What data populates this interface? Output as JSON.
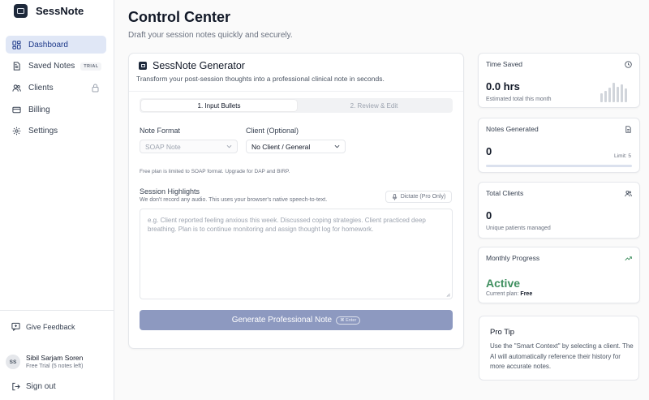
{
  "app": {
    "name": "SessNote"
  },
  "sidebar": {
    "items": [
      {
        "label": "Dashboard",
        "icon": "dashboard-icon",
        "active": true
      },
      {
        "label": "Saved Notes",
        "icon": "notes-icon",
        "badge": "TRIAL"
      },
      {
        "label": "Clients",
        "icon": "users-icon",
        "locked": true
      },
      {
        "label": "Billing",
        "icon": "credit-card-icon"
      },
      {
        "label": "Settings",
        "icon": "gear-icon"
      }
    ],
    "feedback_label": "Give Feedback",
    "user": {
      "initials": "SS",
      "name": "Sibil Sarjam Soren",
      "plan": "Free Trial (5 notes left)"
    },
    "signout_label": "Sign out"
  },
  "header": {
    "title": "Control Center",
    "subtitle": "Draft your session notes quickly and securely."
  },
  "generator": {
    "title": "SessNote Generator",
    "subtitle": "Transform your post-session thoughts into a professional clinical note in seconds.",
    "steps": [
      "1. Input Bullets",
      "2. Review & Edit"
    ],
    "format_label": "Note Format",
    "format_value": "SOAP Note",
    "client_label": "Client (Optional)",
    "client_value": "No Client / General",
    "plan_note": "Free plan is limited to SOAP format. Upgrade for DAP and BIRP.",
    "highlights_label": "Session Highlights",
    "highlights_sub": "We don't record any audio. This uses your browser's native speech-to-text.",
    "dictate_label": "Dictate (Pro Only)",
    "placeholder": "e.g. Client reported feeling anxious this week. Discussed coping strategies. Client practiced deep breathing. Plan is to continue monitoring and assign thought log for homework.",
    "generate_label": "Generate Professional Note",
    "shortcut": "⌘ Enter"
  },
  "stats": {
    "time_saved": {
      "label": "Time Saved",
      "value": "0.0 hrs",
      "caption": "Estimated total this month",
      "bars": [
        0.45,
        0.6,
        0.75,
        1.0,
        0.8,
        0.9,
        0.7
      ]
    },
    "notes_generated": {
      "label": "Notes Generated",
      "value": "0",
      "limit": "Limit: 5",
      "progress": 0
    },
    "total_clients": {
      "label": "Total Clients",
      "value": "0",
      "caption": "Unique patients managed"
    },
    "monthly_progress": {
      "label": "Monthly Progress",
      "value": "Active",
      "plan_prefix": "Current plan:",
      "plan_value": "Free"
    }
  },
  "tip": {
    "title": "Pro Tip",
    "text": "Use the \"Smart Context\" by selecting a client. The AI will automatically reference their history for more accurate notes."
  },
  "colors": {
    "accent": "#1e3a8a",
    "active_nav_bg": "#e0e7f6",
    "button": "#8d99c0",
    "success": "#3f8f5f"
  }
}
